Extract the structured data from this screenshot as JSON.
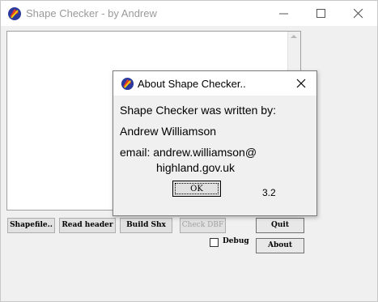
{
  "window": {
    "title": "Shape Checker - by Andrew",
    "controls": {
      "minimize": "minimize-icon",
      "maximize": "maximize-icon",
      "close": "close-icon"
    }
  },
  "buttons": {
    "shapefile": "Shapefile..",
    "read_header": "Read header",
    "build_shx": "Build Shx",
    "check_dbf": "Check DBF",
    "quit": "Quit",
    "about": "About"
  },
  "debug": {
    "label": "Debug",
    "checked": false
  },
  "about_dialog": {
    "title": "About Shape Checker..",
    "line1": "Shape Checker was written by:",
    "line2": "Andrew Williamson",
    "line3": "email: andrew.williamson@",
    "line4": "highland.gov.uk",
    "ok_label": "OK",
    "version": "3.2"
  },
  "colors": {
    "title_inactive": "#9a9a9a",
    "face": "#f0f0f0"
  }
}
